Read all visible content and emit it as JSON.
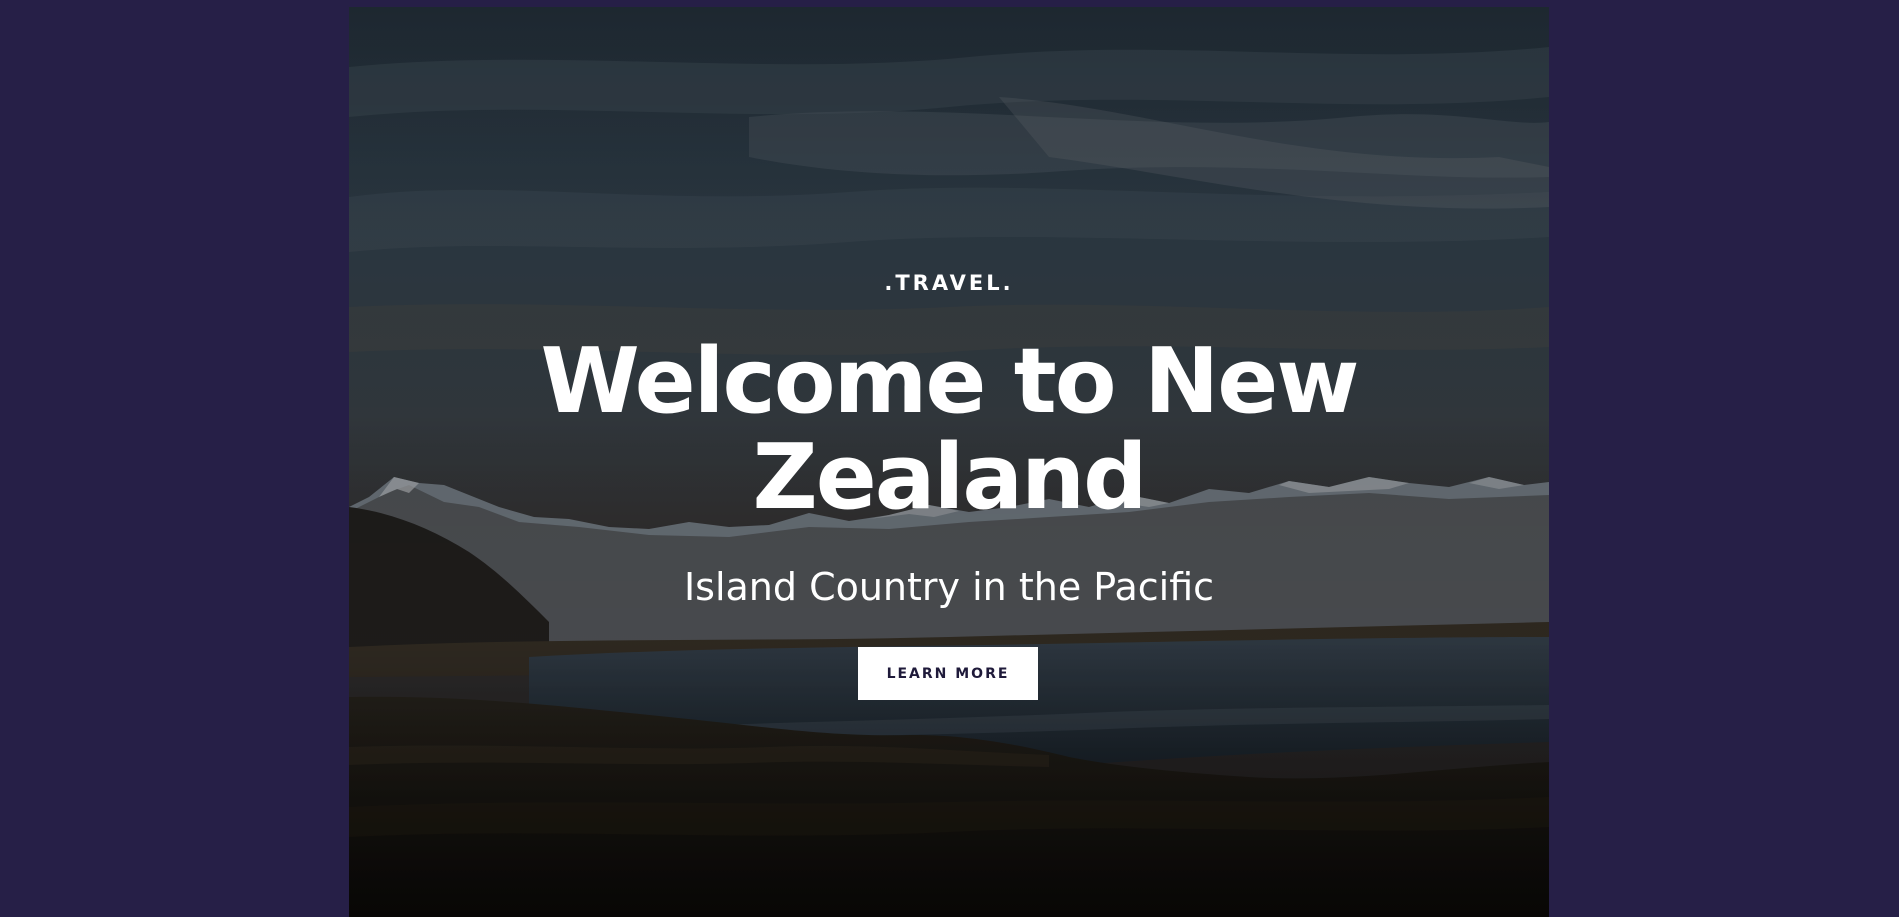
{
  "hero": {
    "eyebrow": ".TRAVEL.",
    "title": "Welcome to New Zealand",
    "subtitle": "Island Country in the Pacific",
    "cta_label": "LEARN MORE"
  },
  "colors": {
    "page_background": "#261f47",
    "button_background": "#ffffff",
    "button_text": "#1f1a3a",
    "text": "#ffffff"
  },
  "background_image": "mountain-lake-landscape"
}
